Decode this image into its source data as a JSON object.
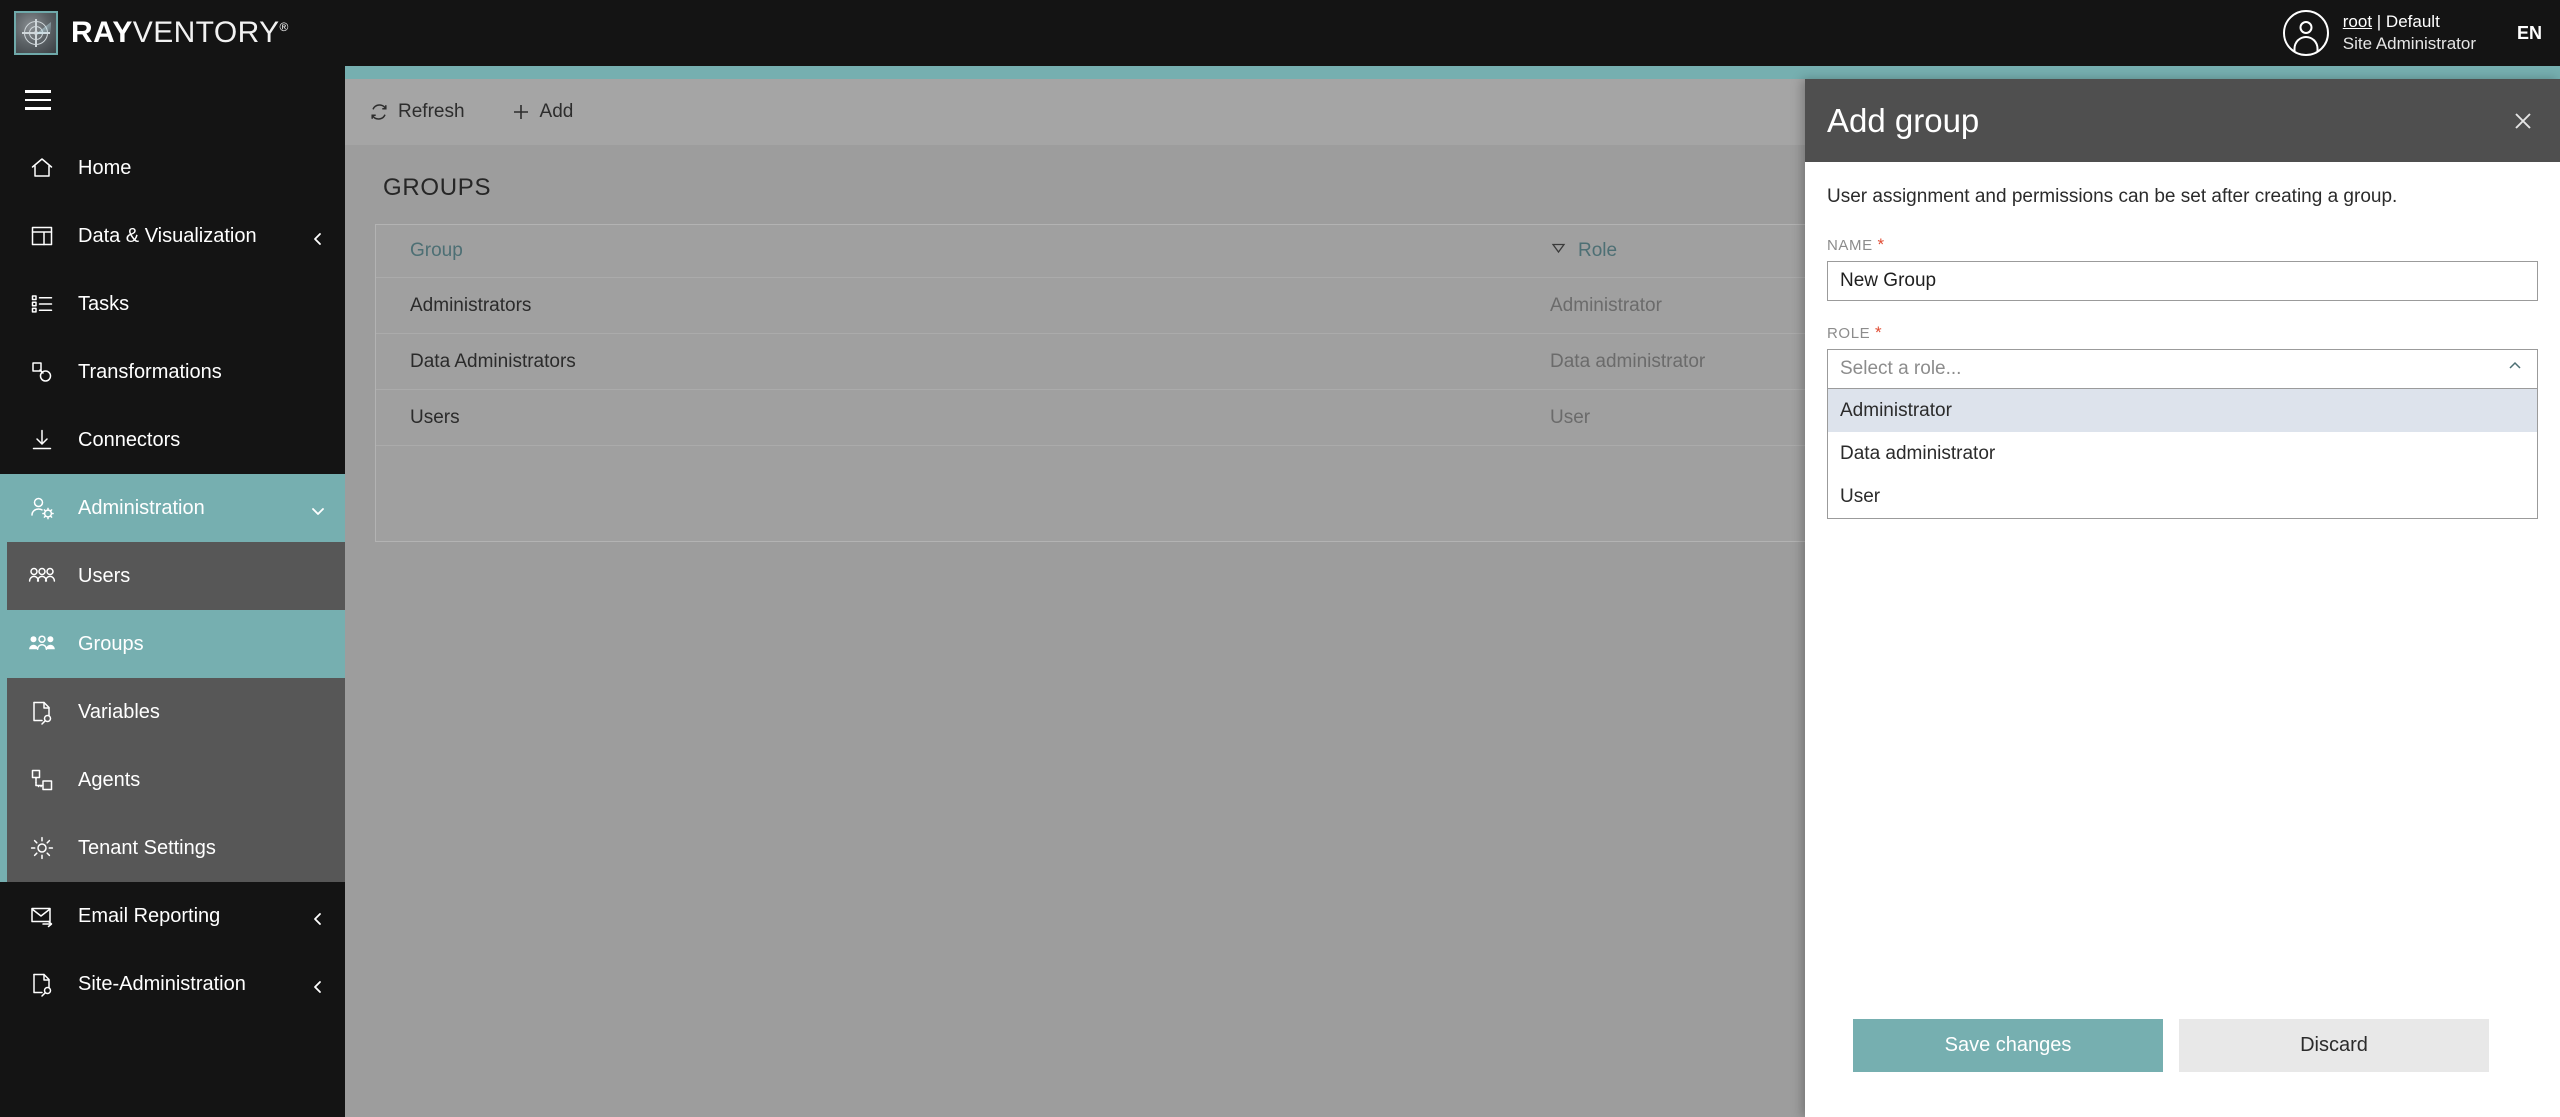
{
  "brand": {
    "strong": "RAY",
    "light": "VENTORY",
    "registered": "®"
  },
  "topbar": {
    "user_line1_link": "root",
    "user_line1_rest": " | Default",
    "user_line2": "Site Administrator",
    "language": "EN"
  },
  "sidebar": {
    "items": [
      {
        "label": "Home",
        "icon": "home-icon",
        "state": "normal",
        "chevron": ""
      },
      {
        "label": "Data & Visualization",
        "icon": "dashboard-icon",
        "state": "normal",
        "chevron": "left"
      },
      {
        "label": "Tasks",
        "icon": "list-icon",
        "state": "normal",
        "chevron": ""
      },
      {
        "label": "Transformations",
        "icon": "transform-icon",
        "state": "normal",
        "chevron": ""
      },
      {
        "label": "Connectors",
        "icon": "download-icon",
        "state": "normal",
        "chevron": ""
      },
      {
        "label": "Administration",
        "icon": "admin-gear-icon",
        "state": "teal",
        "chevron": "down"
      },
      {
        "label": "Users",
        "icon": "users-icon",
        "state": "gray-sub",
        "chevron": ""
      },
      {
        "label": "Groups",
        "icon": "groups-icon",
        "state": "teal-sub",
        "chevron": ""
      },
      {
        "label": "Variables",
        "icon": "variables-icon",
        "state": "gray-sub",
        "chevron": ""
      },
      {
        "label": "Agents",
        "icon": "agents-icon",
        "state": "gray-sub",
        "chevron": ""
      },
      {
        "label": "Tenant Settings",
        "icon": "gear-icon",
        "state": "gray-sub",
        "chevron": ""
      },
      {
        "label": "Email Reporting",
        "icon": "email-icon",
        "state": "normal",
        "chevron": "left"
      },
      {
        "label": "Site-Administration",
        "icon": "site-admin-icon",
        "state": "normal",
        "chevron": "left"
      }
    ]
  },
  "toolbar": {
    "refresh_label": "Refresh",
    "add_label": "Add"
  },
  "main": {
    "page_title": "GROUPS",
    "table": {
      "headers": [
        "Group",
        "Role"
      ],
      "rows": [
        {
          "group": "Administrators",
          "role": "Administrator"
        },
        {
          "group": "Data Administrators",
          "role": "Data administrator"
        },
        {
          "group": "Users",
          "role": "User"
        }
      ]
    }
  },
  "panel": {
    "title": "Add group",
    "description": "User assignment and permissions can be set after creating a group.",
    "name_label": "NAME",
    "name_value": "New Group",
    "role_label": "ROLE",
    "role_placeholder": "Select a role...",
    "role_options": [
      "Administrator",
      "Data administrator",
      "User"
    ],
    "save_label": "Save changes",
    "discard_label": "Discard"
  },
  "colors": {
    "accent_teal": "#76afb0",
    "header_black": "#141414",
    "panel_header_gray": "#4f4f4f",
    "required_red": "#e04b32",
    "option_highlight": "#dde3ec"
  }
}
